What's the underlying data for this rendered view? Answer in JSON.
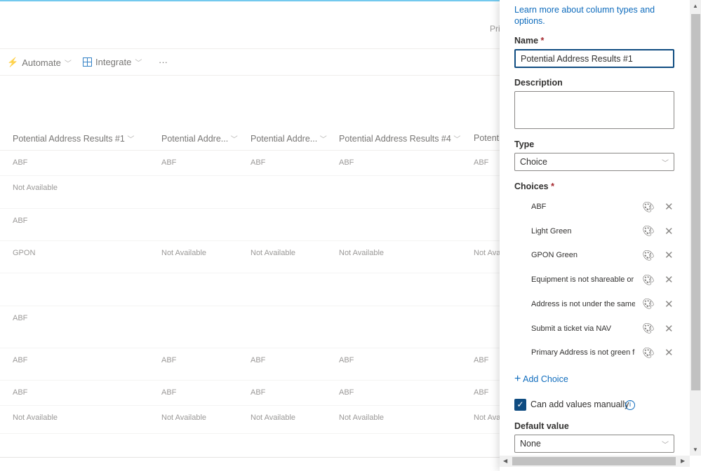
{
  "header": {
    "truncated_text": "Pri"
  },
  "commandbar": {
    "automate": "Automate",
    "integrate": "Integrate",
    "more": "···"
  },
  "table": {
    "columns": [
      "Potential Address Results #1",
      "Potential Addre...",
      "Potential Addre...",
      "Potential Address Results #4",
      "Potenti"
    ],
    "rows": [
      [
        "ABF",
        "ABF",
        "ABF",
        "ABF",
        "ABF"
      ],
      [
        "Not Available",
        "",
        "",
        "",
        ""
      ],
      [
        "ABF",
        "",
        "",
        "",
        ""
      ],
      [
        "GPON",
        "Not Available",
        "Not Available",
        "Not Available",
        "Not Avai"
      ],
      [
        "",
        "",
        "",
        "",
        ""
      ],
      [
        "ABF",
        "",
        "",
        "",
        ""
      ],
      [
        "ABF",
        "ABF",
        "ABF",
        "ABF",
        "ABF"
      ],
      [
        "ABF",
        "ABF",
        "ABF",
        "ABF",
        "ABF"
      ],
      [
        "Not Available",
        "Not Available",
        "Not Available",
        "Not Available",
        "Not Avai"
      ]
    ]
  },
  "panel": {
    "learn_more": "Learn more about column types and options.",
    "name_label": "Name",
    "required": "*",
    "name_value": "Potential Address Results #1",
    "description_label": "Description",
    "description_value": "",
    "type_label": "Type",
    "type_value": "Choice",
    "choices_label": "Choices",
    "choices": [
      "ABF",
      "Light Green",
      "GPON Green",
      "Equipment is not shareable or in",
      "Address is not under the same rc",
      "Submit a ticket via NAV",
      "Primary Address is not green for"
    ],
    "add_choice": "Add Choice",
    "can_add_manually": "Can add values manually",
    "can_add_manually_checked": true,
    "default_label": "Default value",
    "default_value": "None"
  },
  "colors": {
    "accent": "#0f6cbd",
    "checkbox": "#0f4c81",
    "topbar": "#5bc0eb"
  }
}
